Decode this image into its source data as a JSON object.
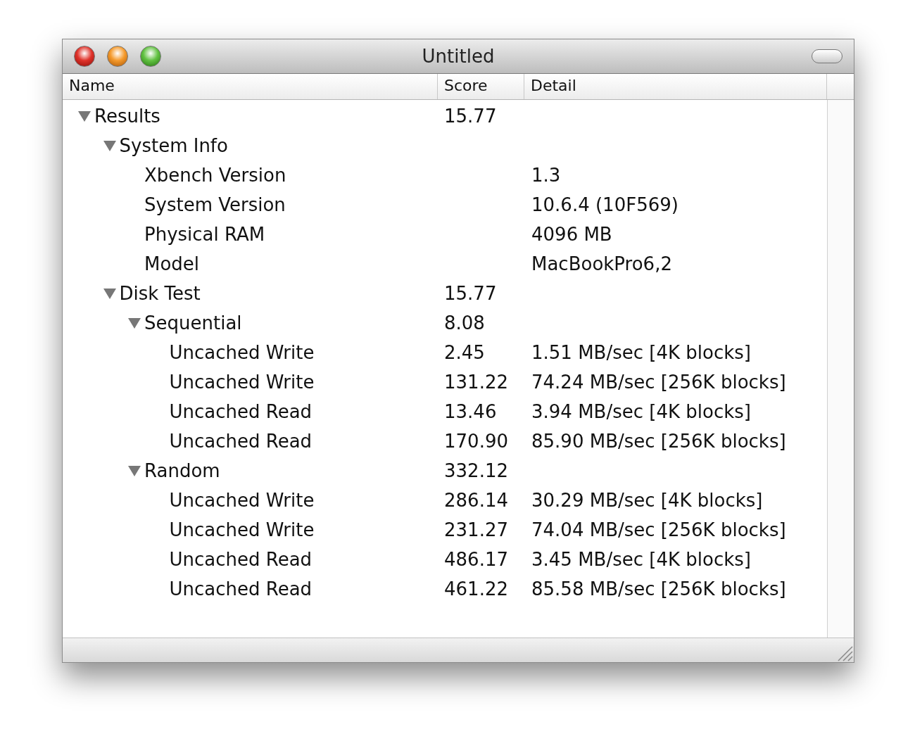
{
  "window": {
    "title": "Untitled"
  },
  "table": {
    "columns": [
      "Name",
      "Score",
      "Detail"
    ],
    "rows": [
      {
        "name": "Results",
        "score": "15.77",
        "expanded": true,
        "children": [
          {
            "name": "System Info",
            "expanded": true,
            "children": [
              {
                "name": "Xbench Version",
                "detail": "1.3"
              },
              {
                "name": "System Version",
                "detail": "10.6.4 (10F569)"
              },
              {
                "name": "Physical RAM",
                "detail": "4096 MB"
              },
              {
                "name": "Model",
                "detail": "MacBookPro6,2"
              }
            ]
          },
          {
            "name": "Disk Test",
            "score": "15.77",
            "expanded": true,
            "children": [
              {
                "name": "Sequential",
                "score": "8.08",
                "expanded": true,
                "children": [
                  {
                    "name": "Uncached Write",
                    "score": "2.45",
                    "detail": "1.51 MB/sec [4K blocks]"
                  },
                  {
                    "name": "Uncached Write",
                    "score": "131.22",
                    "detail": "74.24 MB/sec [256K blocks]"
                  },
                  {
                    "name": "Uncached Read",
                    "score": "13.46",
                    "detail": "3.94 MB/sec [4K blocks]"
                  },
                  {
                    "name": "Uncached Read",
                    "score": "170.90",
                    "detail": "85.90 MB/sec [256K blocks]"
                  }
                ]
              },
              {
                "name": "Random",
                "score": "332.12",
                "expanded": true,
                "children": [
                  {
                    "name": "Uncached Write",
                    "score": "286.14",
                    "detail": "30.29 MB/sec [4K blocks]"
                  },
                  {
                    "name": "Uncached Write",
                    "score": "231.27",
                    "detail": "74.04 MB/sec [256K blocks]"
                  },
                  {
                    "name": "Uncached Read",
                    "score": "486.17",
                    "detail": "3.45 MB/sec [4K blocks]"
                  },
                  {
                    "name": "Uncached Read",
                    "score": "461.22",
                    "detail": "85.58 MB/sec [256K blocks]"
                  }
                ]
              }
            ]
          }
        ]
      }
    ]
  }
}
